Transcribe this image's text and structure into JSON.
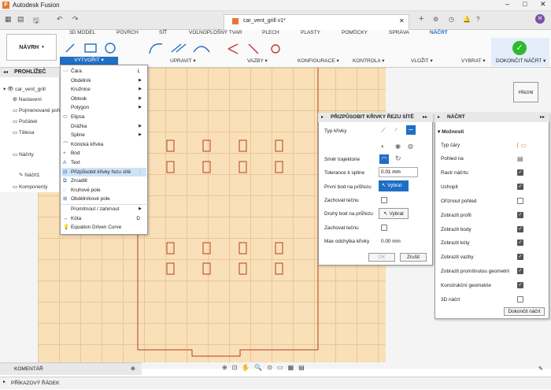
{
  "app": {
    "title": "Autodesk Fusion",
    "doc_tab": "car_vent_grill v1*"
  },
  "workspace": {
    "label": "NÁVRH"
  },
  "ribbon_tabs": [
    "3D MODEL",
    "POVRCH",
    "SÍŤ",
    "VOLNOPLOŠNÝ TVAR",
    "PLECH",
    "PLASTY",
    "POMŮCKY",
    "SPRÁVA",
    "NÁČRT"
  ],
  "ribbon_groups": {
    "create": "VYTVOŘIT ▾",
    "modify": "UPRAVIT ▾",
    "constraints": "VAZBY ▾",
    "config": "KONFIGURACE ▾",
    "inspect": "KONTROLA ▾",
    "insert": "VLOŽIT ▾",
    "select": "VYBRAT ▾",
    "finish": "DOKONČIT NÁČRT ▾"
  },
  "browser": {
    "title": "PROHLÍŽEČ",
    "items": [
      "car_vent_grill",
      "Nastavení",
      "Pojmenované pohledy",
      "Počátek",
      "Tělesa",
      "Náčrty",
      "Náčrt1",
      "Komponenty"
    ]
  },
  "create_menu": [
    {
      "icon": "line-icon",
      "label": "Čára",
      "shortcut": "L"
    },
    {
      "label": "Obdélník",
      "arrow": "▶"
    },
    {
      "label": "Kružnice",
      "arrow": "▶"
    },
    {
      "label": "Oblouk",
      "arrow": "▶"
    },
    {
      "label": "Polygon",
      "arrow": "▶"
    },
    {
      "icon": "ellipse-icon",
      "label": "Elipsa"
    },
    {
      "label": "Drážka",
      "arrow": "▶"
    },
    {
      "label": "Spline",
      "arrow": "▶"
    },
    {
      "icon": "conic-icon",
      "label": "Kónická křivka"
    },
    {
      "icon": "point-icon",
      "label": "Bod"
    },
    {
      "icon": "text-icon",
      "label": "Text"
    },
    {
      "icon": "fit-curve-icon",
      "label": "Přizpůsobit křivky řezu sítě",
      "arrow": "⋮",
      "highlight": true
    },
    {
      "icon": "mirror-icon",
      "label": "Zrcadlit"
    },
    {
      "icon": "circular-pattern-icon",
      "label": "Kruhové pole"
    },
    {
      "icon": "rect-pattern-icon",
      "label": "Obdélníkové pole"
    },
    {
      "label": "Promítnout / zahrnout",
      "arrow": "▶"
    },
    {
      "icon": "dimension-icon",
      "label": "Kóta",
      "shortcut": "D"
    },
    {
      "icon": "bulb-icon",
      "label": "Equation Driven Curve"
    }
  ],
  "fit_dialog": {
    "title": "PŘIZPŮSOBIT KŘIVKY ŘEZU SÍTĚ",
    "curve_type": "Typ křivky",
    "direction": "Směr trajektorie",
    "tolerance_label": "Tolerance k spline",
    "tolerance_value": "0.01 mm",
    "first_point": "První bod na průřezu",
    "select_active": "Vybrat",
    "keep_tangent1": "Zachovat tečnu",
    "second_point": "Druhý bod na průřezu",
    "select": "Vybrat",
    "keep_tangent2": "Zachovat tečnu",
    "max_dev_label": "Max odchylka křivky",
    "max_dev_value": "0.00 mm",
    "ok": "OK",
    "cancel": "Zrušit"
  },
  "sketch_palette": {
    "title": "NÁČRT",
    "section": "Možnosti",
    "rows": [
      {
        "label": "Typ čáry",
        "control": "line"
      },
      {
        "label": "Pohled na",
        "control": "view"
      },
      {
        "label": "Rastr náčrtu",
        "checked": true
      },
      {
        "label": "Uchopit",
        "checked": true
      },
      {
        "label": "Oříznout pohled",
        "checked": false
      },
      {
        "label": "Zobrazit profil",
        "checked": true
      },
      {
        "label": "Zobrazit body",
        "checked": true
      },
      {
        "label": "Zobrazit kóty",
        "checked": true
      },
      {
        "label": "Zobrazit vazby",
        "checked": true
      },
      {
        "label": "Zobrazit promítnutou geometrii",
        "checked": true
      },
      {
        "label": "Konstrukční geometrie",
        "checked": true
      },
      {
        "label": "3D náčrt",
        "checked": false
      }
    ],
    "finish": "Dokončit náčrt"
  },
  "viewcube": {
    "label": "PŘEDNÍ"
  },
  "comments": {
    "label": "KOMENTÁŘ"
  },
  "command_line": {
    "label": "PŘÍKAZOVÝ ŘÁDEK"
  },
  "colors": {
    "accent": "#1f6fc4",
    "grid": "#fae0b8",
    "outline": "#b04020",
    "finish": "#2eb82e"
  }
}
